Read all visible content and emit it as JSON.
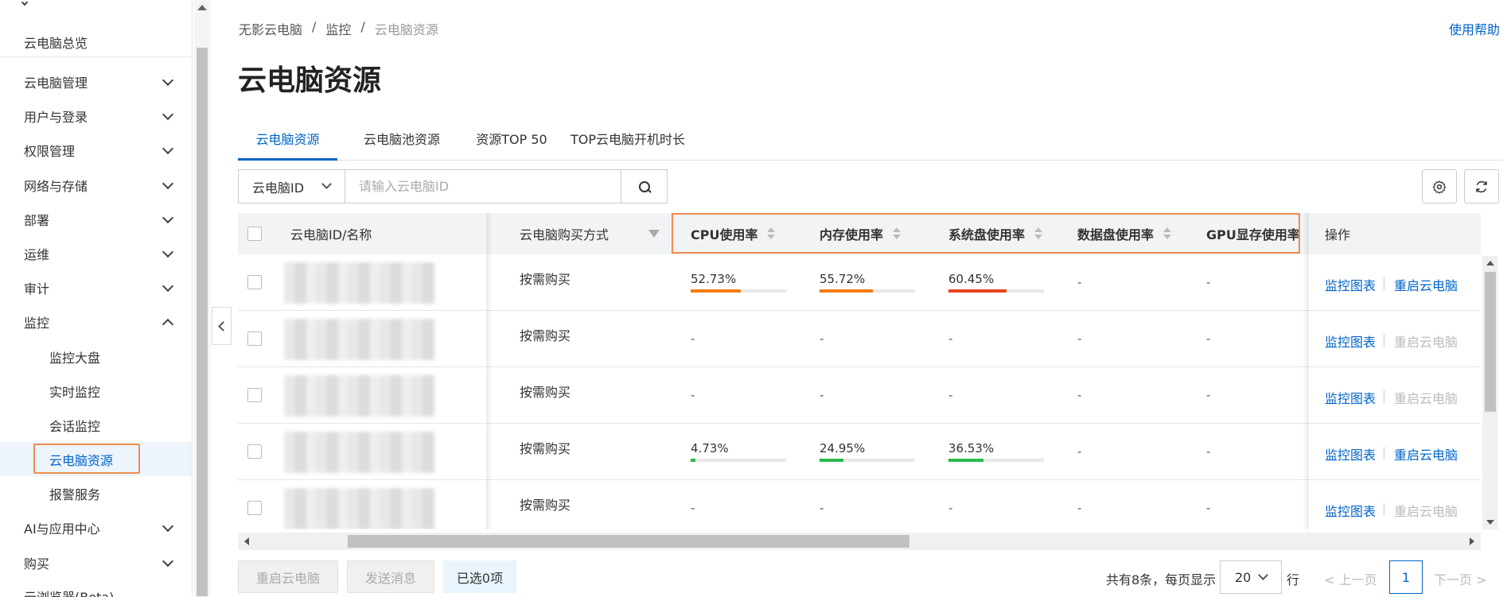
{
  "sidebar": {
    "items": [
      {
        "label": "云电脑总览"
      },
      {
        "label": "云电脑管理"
      },
      {
        "label": "用户与登录"
      },
      {
        "label": "权限管理"
      },
      {
        "label": "网络与存储"
      },
      {
        "label": "部署"
      },
      {
        "label": "运维"
      },
      {
        "label": "审计"
      },
      {
        "label": "监控"
      },
      {
        "label": "监控大盘"
      },
      {
        "label": "实时监控"
      },
      {
        "label": "会话监控"
      },
      {
        "label": "云电脑资源"
      },
      {
        "label": "报警服务"
      },
      {
        "label": "AI与应用中心"
      },
      {
        "label": "购买"
      },
      {
        "label": "云浏览器(Beta)"
      }
    ]
  },
  "breadcrumb": [
    "无影云电脑",
    "监控",
    "云电脑资源"
  ],
  "breadcrumb_sep": "/",
  "help": "使用帮助",
  "title": "云电脑资源",
  "tabs": [
    "云电脑资源",
    "云电脑池资源",
    "资源TOP 50",
    "TOP云电脑开机时长"
  ],
  "search": {
    "field": "云电脑ID",
    "placeholder": "请输入云电脑ID"
  },
  "toolbar": {
    "settings_icon": "gear-icon",
    "refresh_icon": "refresh-icon"
  },
  "table": {
    "headers": [
      "云电脑ID/名称",
      "云电脑购买方式",
      "CPU使用率",
      "内存使用率",
      "系统盘使用率",
      "数据盘使用率",
      "GPU显存使用率",
      "操作"
    ],
    "rows": [
      {
        "purchase": "按需购买",
        "cpu": "52.73%",
        "cpu_v": 0.527,
        "mem": "55.72%",
        "mem_v": 0.557,
        "sys": "60.45%",
        "sys_v": 0.605,
        "data": "-",
        "gpu": "-",
        "op1": "监控图表",
        "op2": "重启云电脑",
        "op2_enabled": true
      },
      {
        "purchase": "按需购买",
        "cpu": "-",
        "mem": "-",
        "sys": "-",
        "data": "-",
        "gpu": "-",
        "op1": "监控图表",
        "op2": "重启云电脑",
        "op2_enabled": false
      },
      {
        "purchase": "按需购买",
        "cpu": "-",
        "mem": "-",
        "sys": "-",
        "data": "-",
        "gpu": "-",
        "op1": "监控图表",
        "op2": "重启云电脑",
        "op2_enabled": false
      },
      {
        "purchase": "按需购买",
        "cpu": "4.73%",
        "cpu_v": 0.047,
        "mem": "24.95%",
        "mem_v": 0.25,
        "sys": "36.53%",
        "sys_v": 0.365,
        "data": "-",
        "gpu": "-",
        "op1": "监控图表",
        "op2": "重启云电脑",
        "op2_enabled": true
      },
      {
        "purchase": "按需购买",
        "cpu": "-",
        "mem": "-",
        "sys": "-",
        "data": "-",
        "gpu": "-",
        "op1": "监控图表",
        "op2": "重启云电脑",
        "op2_enabled": false
      }
    ]
  },
  "footer": {
    "restart": "重启云电脑",
    "send_message": "发送消息",
    "selected": "已选0项",
    "total": "共有8条，每页显示",
    "page_size": "20",
    "rows_unit": "行",
    "prev": "< 上一页",
    "current_page": "1",
    "next": "下一页 >"
  },
  "colors": {
    "accent": "#0064c8",
    "highlight": "#f08c4f",
    "orange": "#f07c14",
    "red": "#e8421c",
    "green": "#2bb94a"
  }
}
